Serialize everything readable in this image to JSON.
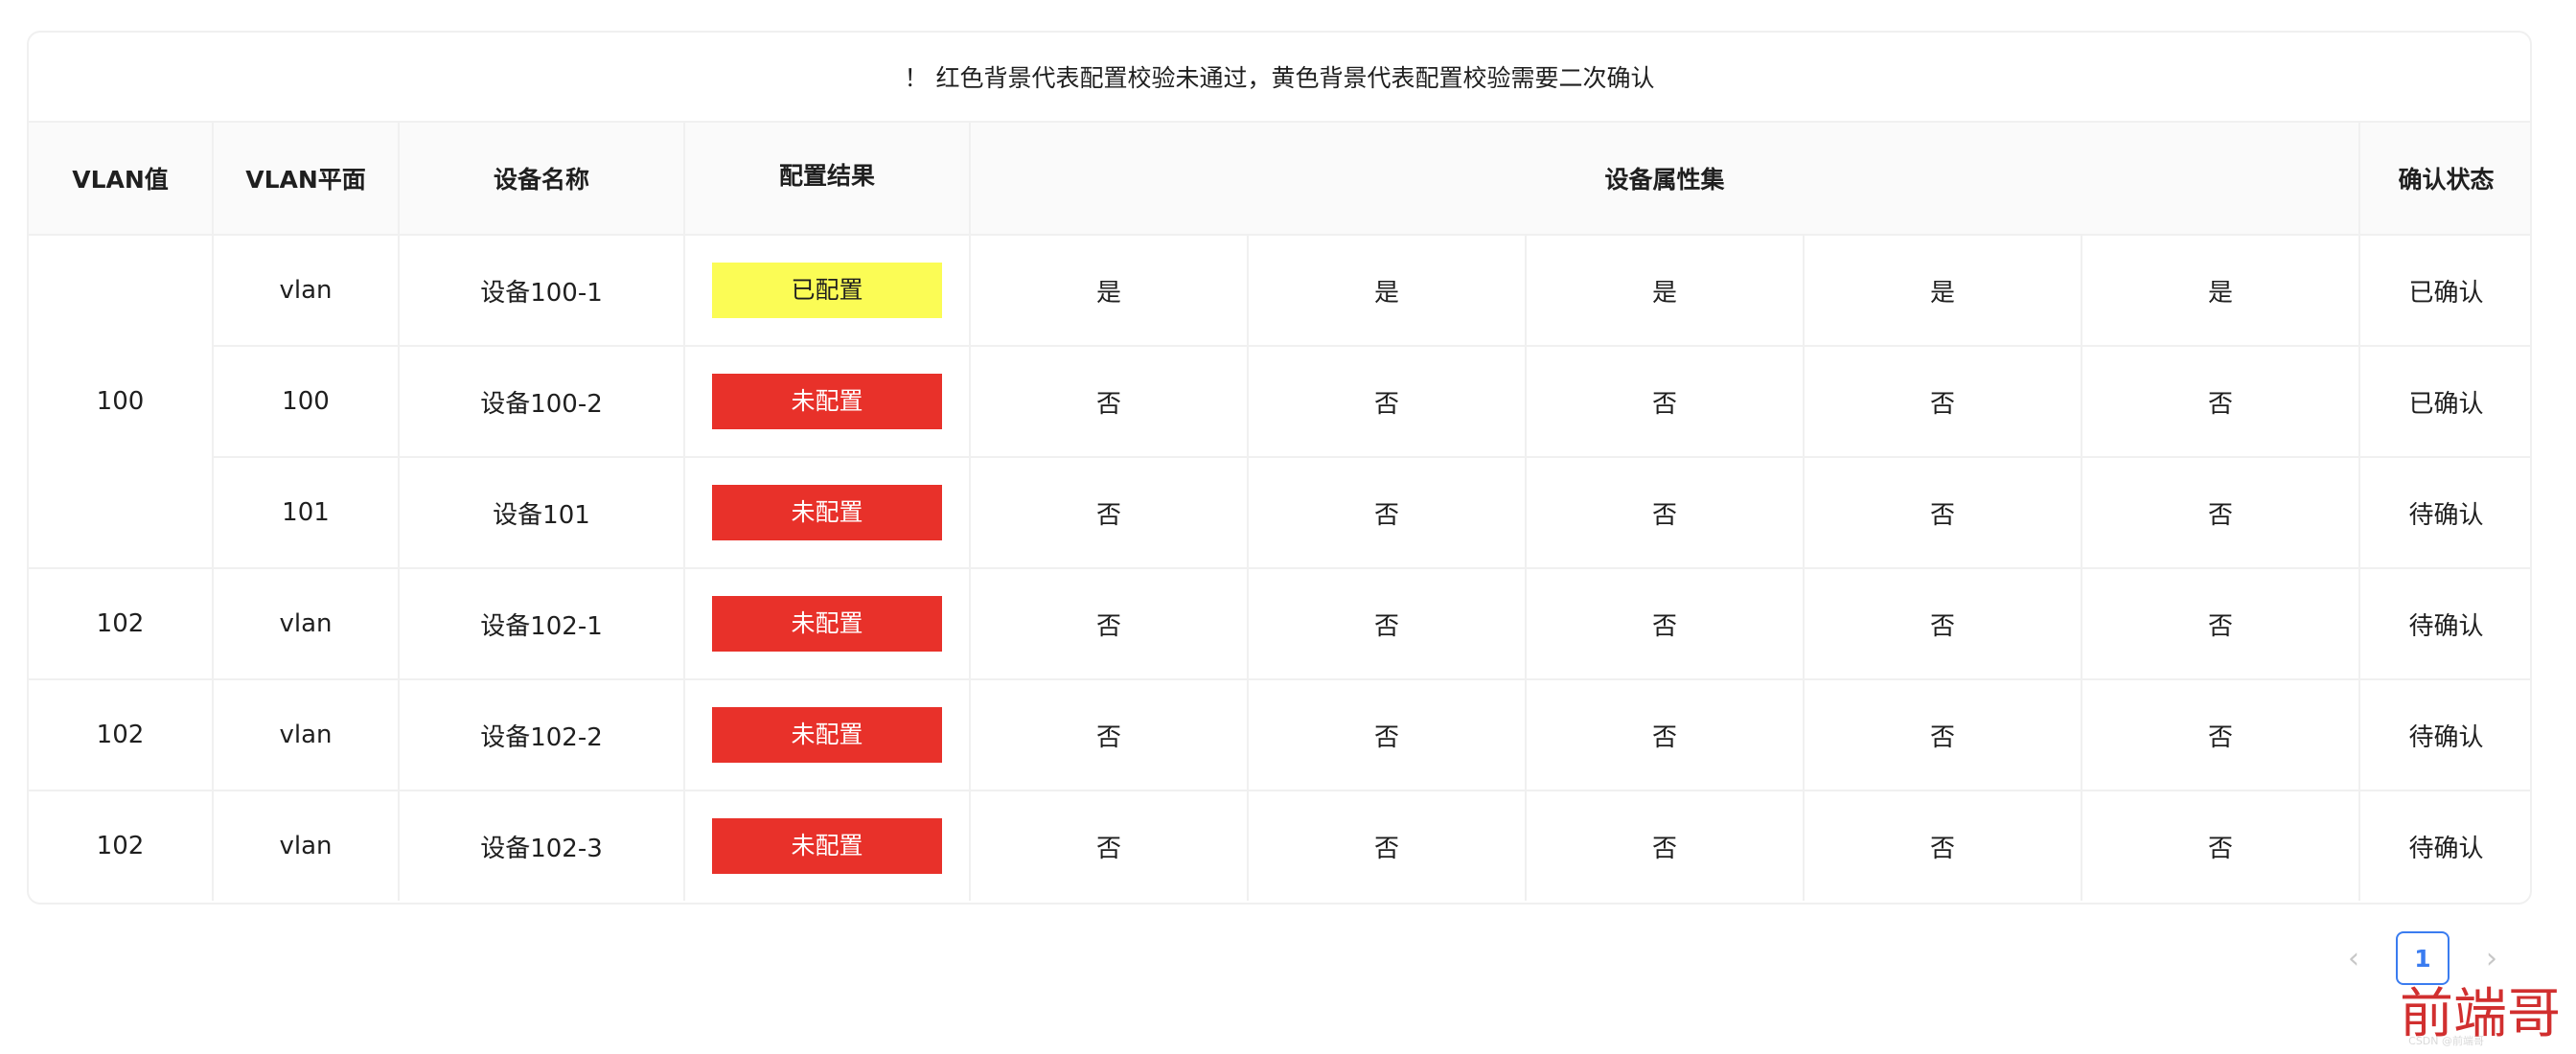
{
  "notice": "！ 红色背景代表配置校验未通过，黄色背景代表配置校验需要二次确认",
  "headers": {
    "vlan_value": "VLAN值",
    "vlan_plane": "VLAN平面",
    "device_name": "设备名称",
    "config_result": "配置结果",
    "device_attributes": "设备属性集",
    "confirm_status": "确认状态"
  },
  "rows": [
    {
      "plane": "vlan",
      "device": "设备100-1",
      "result": "已配置",
      "attrs": [
        "是",
        "是",
        "是",
        "是",
        "是"
      ],
      "status": "已确认"
    },
    {
      "plane": "100",
      "device": "设备100-2",
      "result": "未配置",
      "attrs": [
        "否",
        "否",
        "否",
        "否",
        "否"
      ],
      "status": "已确认"
    },
    {
      "plane": "101",
      "device": "设备101",
      "result": "未配置",
      "attrs": [
        "否",
        "否",
        "否",
        "否",
        "否"
      ],
      "status": "待确认"
    },
    {
      "vlan": "102",
      "plane": "vlan",
      "device": "设备102-1",
      "result": "未配置",
      "attrs": [
        "否",
        "否",
        "否",
        "否",
        "否"
      ],
      "status": "待确认"
    },
    {
      "vlan": "102",
      "plane": "vlan",
      "device": "设备102-2",
      "result": "未配置",
      "attrs": [
        "否",
        "否",
        "否",
        "否",
        "否"
      ],
      "status": "待确认"
    },
    {
      "vlan": "102",
      "plane": "vlan",
      "device": "设备102-3",
      "result": "未配置",
      "attrs": [
        "否",
        "否",
        "否",
        "否",
        "否"
      ],
      "status": "待确认"
    }
  ],
  "merged_vlan": "100",
  "colors": {
    "configured_bg": "#fbfc55",
    "configured_text": "#1f1f1f",
    "unconfigured_bg": "#e8312a",
    "unconfigured_text": "#ffffff",
    "accent": "#3a7cf0"
  },
  "pagination": {
    "prev_icon": "chevron-left-icon",
    "current_page": "1",
    "next_icon": "chevron-right-icon"
  },
  "watermark": "前端哥",
  "watermark_small": "CSDN @前端哥"
}
